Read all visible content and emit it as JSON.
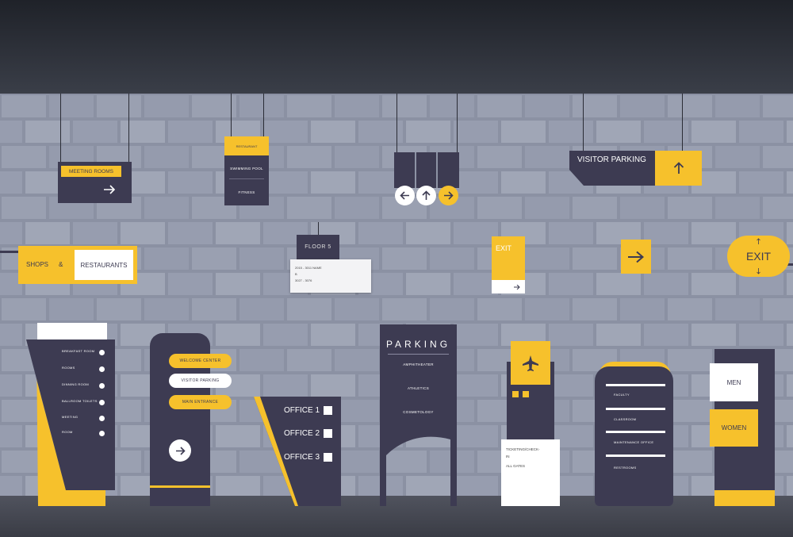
{
  "colors": {
    "navy": "#3d3b52",
    "yellow": "#f6c12c",
    "wall": "#8d93a5",
    "white": "#ffffff"
  },
  "signs": {
    "meeting_rooms": {
      "label": "MEETING ROOMS",
      "icon": "arrow-right-icon"
    },
    "restaurant_menu": {
      "header": "RESTAURANT",
      "items": [
        "SWIMMING POOL",
        "FITNESS"
      ]
    },
    "direction_signs": {
      "icons": [
        "arrow-left-icon",
        "arrow-up-icon",
        "arrow-right-icon"
      ]
    },
    "visitor_parking": {
      "label": "VISITOR PARKING",
      "icon": "arrow-up-icon"
    },
    "shops_restaurants": {
      "left": "SHOPS",
      "amp": "&",
      "right": "RESTAURANTS"
    },
    "floor_sign": {
      "title": "FLOOR 5",
      "lines": [
        "2015 - 3011 NAME",
        "B",
        "3027 - 3076"
      ]
    },
    "exit_small": {
      "label": "EXIT"
    },
    "arrow_square": {
      "icon": "arrow-right-icon"
    },
    "exit_oval": {
      "label": "EXIT"
    },
    "directory": {
      "items": [
        "BREAKFAST ROOM",
        "ROOMS",
        "DINNING ROOM",
        "BALLROOM TOILETS",
        "MEETING",
        "ROOM"
      ]
    },
    "kiosk": {
      "buttons": [
        "WELCOME CENTER",
        "VISITOR PARKING",
        "MAIN ENTRANCE"
      ],
      "icon": "arrow-right-icon"
    },
    "offices": {
      "items": [
        "OFFICE 1",
        "OFFICE 2",
        "OFFICE 3"
      ]
    },
    "parking_totem": {
      "title": "PARKING",
      "items": [
        "AMPHITHEATER",
        "ATHLETICS",
        "COSMETOLOGY"
      ]
    },
    "airport": {
      "icon": "airplane-icon",
      "lines": [
        "TICKETING/CHECK-",
        "IN",
        "ALL GATES"
      ]
    },
    "rounded_totem": {
      "items": [
        "FACULTY",
        "CLASSROOM",
        "MAINTENANCE OFFICE",
        "RESTROOMS"
      ]
    },
    "restrooms": {
      "men": "MEN",
      "women": "WOMEN"
    }
  }
}
